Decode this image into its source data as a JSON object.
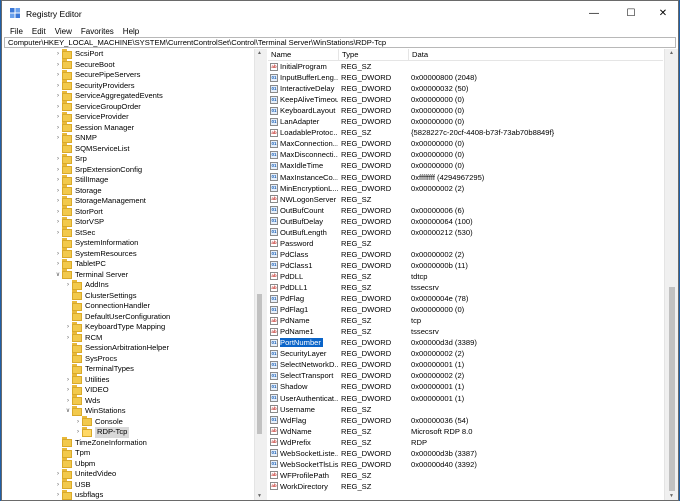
{
  "title": "Registry Editor",
  "window_controls": {
    "minimize": "—",
    "maximize": "☐",
    "close": "✕"
  },
  "menu": [
    "File",
    "Edit",
    "View",
    "Favorites",
    "Help"
  ],
  "address": "Computer\\HKEY_LOCAL_MACHINE\\SYSTEM\\CurrentControlSet\\Control\\Terminal Server\\WinStations\\RDP-Tcp",
  "tree": [
    {
      "label": "ScsiPort",
      "depth": 0,
      "exp": "collapsed"
    },
    {
      "label": "SecureBoot",
      "depth": 0,
      "exp": "collapsed"
    },
    {
      "label": "SecurePipeServers",
      "depth": 0,
      "exp": "collapsed"
    },
    {
      "label": "SecurityProviders",
      "depth": 0,
      "exp": "collapsed"
    },
    {
      "label": "ServiceAggregatedEvents",
      "depth": 0,
      "exp": "collapsed"
    },
    {
      "label": "ServiceGroupOrder",
      "depth": 0,
      "exp": "collapsed"
    },
    {
      "label": "ServiceProvider",
      "depth": 0,
      "exp": "collapsed"
    },
    {
      "label": "Session Manager",
      "depth": 0,
      "exp": "collapsed"
    },
    {
      "label": "SNMP",
      "depth": 0,
      "exp": "collapsed"
    },
    {
      "label": "SQMServiceList",
      "depth": 0,
      "exp": "none"
    },
    {
      "label": "Srp",
      "depth": 0,
      "exp": "collapsed"
    },
    {
      "label": "SrpExtensionConfig",
      "depth": 0,
      "exp": "collapsed"
    },
    {
      "label": "StillImage",
      "depth": 0,
      "exp": "collapsed"
    },
    {
      "label": "Storage",
      "depth": 0,
      "exp": "collapsed"
    },
    {
      "label": "StorageManagement",
      "depth": 0,
      "exp": "collapsed"
    },
    {
      "label": "StorPort",
      "depth": 0,
      "exp": "collapsed"
    },
    {
      "label": "StorVSP",
      "depth": 0,
      "exp": "collapsed"
    },
    {
      "label": "StSec",
      "depth": 0,
      "exp": "collapsed"
    },
    {
      "label": "SystemInformation",
      "depth": 0,
      "exp": "none"
    },
    {
      "label": "SystemResources",
      "depth": 0,
      "exp": "collapsed"
    },
    {
      "label": "TabletPC",
      "depth": 0,
      "exp": "collapsed"
    },
    {
      "label": "Terminal Server",
      "depth": 0,
      "exp": "expanded"
    },
    {
      "label": "AddIns",
      "depth": 1,
      "exp": "collapsed"
    },
    {
      "label": "ClusterSettings",
      "depth": 1,
      "exp": "none"
    },
    {
      "label": "ConnectionHandler",
      "depth": 1,
      "exp": "none"
    },
    {
      "label": "DefaultUserConfiguration",
      "depth": 1,
      "exp": "none"
    },
    {
      "label": "KeyboardType Mapping",
      "depth": 1,
      "exp": "collapsed"
    },
    {
      "label": "RCM",
      "depth": 1,
      "exp": "collapsed"
    },
    {
      "label": "SessionArbitrationHelper",
      "depth": 1,
      "exp": "none"
    },
    {
      "label": "SysProcs",
      "depth": 1,
      "exp": "none"
    },
    {
      "label": "TerminalTypes",
      "depth": 1,
      "exp": "none"
    },
    {
      "label": "Utilities",
      "depth": 1,
      "exp": "collapsed"
    },
    {
      "label": "VIDEO",
      "depth": 1,
      "exp": "collapsed"
    },
    {
      "label": "Wds",
      "depth": 1,
      "exp": "collapsed"
    },
    {
      "label": "WinStations",
      "depth": 1,
      "exp": "expanded"
    },
    {
      "label": "Console",
      "depth": 2,
      "exp": "collapsed"
    },
    {
      "label": "RDP-Tcp",
      "depth": 2,
      "exp": "collapsed",
      "selected": true
    },
    {
      "label": "TimeZoneInformation",
      "depth": 0,
      "exp": "none"
    },
    {
      "label": "Tpm",
      "depth": 0,
      "exp": "none"
    },
    {
      "label": "Ubpm",
      "depth": 0,
      "exp": "none"
    },
    {
      "label": "UnitedVideo",
      "depth": 0,
      "exp": "collapsed"
    },
    {
      "label": "USB",
      "depth": 0,
      "exp": "collapsed"
    },
    {
      "label": "usbflags",
      "depth": 0,
      "exp": "collapsed"
    }
  ],
  "columns": {
    "name": "Name",
    "type": "Type",
    "data": "Data"
  },
  "values": [
    {
      "name": "InitialProgram",
      "type": "REG_SZ",
      "data": ""
    },
    {
      "name": "InputBufferLeng...",
      "type": "REG_DWORD",
      "data": "0x00000800 (2048)"
    },
    {
      "name": "InteractiveDelay",
      "type": "REG_DWORD",
      "data": "0x00000032 (50)"
    },
    {
      "name": "KeepAliveTimeout",
      "type": "REG_DWORD",
      "data": "0x00000000 (0)"
    },
    {
      "name": "KeyboardLayout",
      "type": "REG_DWORD",
      "data": "0x00000000 (0)"
    },
    {
      "name": "LanAdapter",
      "type": "REG_DWORD",
      "data": "0x00000000 (0)"
    },
    {
      "name": "LoadableProtoc...",
      "type": "REG_SZ",
      "data": "{5828227c-20cf-4408-b73f-73ab70b8849f}"
    },
    {
      "name": "MaxConnection...",
      "type": "REG_DWORD",
      "data": "0x00000000 (0)"
    },
    {
      "name": "MaxDisconnecti...",
      "type": "REG_DWORD",
      "data": "0x00000000 (0)"
    },
    {
      "name": "MaxIdleTime",
      "type": "REG_DWORD",
      "data": "0x00000000 (0)"
    },
    {
      "name": "MaxInstanceCo...",
      "type": "REG_DWORD",
      "data": "0xffffffff (4294967295)"
    },
    {
      "name": "MinEncryptionL...",
      "type": "REG_DWORD",
      "data": "0x00000002 (2)"
    },
    {
      "name": "NWLogonServer",
      "type": "REG_SZ",
      "data": ""
    },
    {
      "name": "OutBufCount",
      "type": "REG_DWORD",
      "data": "0x00000006 (6)"
    },
    {
      "name": "OutBufDelay",
      "type": "REG_DWORD",
      "data": "0x00000064 (100)"
    },
    {
      "name": "OutBufLength",
      "type": "REG_DWORD",
      "data": "0x00000212 (530)"
    },
    {
      "name": "Password",
      "type": "REG_SZ",
      "data": ""
    },
    {
      "name": "PdClass",
      "type": "REG_DWORD",
      "data": "0x00000002 (2)"
    },
    {
      "name": "PdClass1",
      "type": "REG_DWORD",
      "data": "0x0000000b (11)"
    },
    {
      "name": "PdDLL",
      "type": "REG_SZ",
      "data": "tdtcp"
    },
    {
      "name": "PdDLL1",
      "type": "REG_SZ",
      "data": "tssecsrv"
    },
    {
      "name": "PdFlag",
      "type": "REG_DWORD",
      "data": "0x0000004e (78)"
    },
    {
      "name": "PdFlag1",
      "type": "REG_DWORD",
      "data": "0x00000000 (0)"
    },
    {
      "name": "PdName",
      "type": "REG_SZ",
      "data": "tcp"
    },
    {
      "name": "PdName1",
      "type": "REG_SZ",
      "data": "tssecsrv"
    },
    {
      "name": "PortNumber",
      "type": "REG_DWORD",
      "data": "0x00000d3d (3389)",
      "selected": true
    },
    {
      "name": "SecurityLayer",
      "type": "REG_DWORD",
      "data": "0x00000002 (2)"
    },
    {
      "name": "SelectNetworkD...",
      "type": "REG_DWORD",
      "data": "0x00000001 (1)"
    },
    {
      "name": "SelectTransport",
      "type": "REG_DWORD",
      "data": "0x00000002 (2)"
    },
    {
      "name": "Shadow",
      "type": "REG_DWORD",
      "data": "0x00000001 (1)"
    },
    {
      "name": "UserAuthenticat...",
      "type": "REG_DWORD",
      "data": "0x00000001 (1)"
    },
    {
      "name": "Username",
      "type": "REG_SZ",
      "data": ""
    },
    {
      "name": "WdFlag",
      "type": "REG_DWORD",
      "data": "0x00000036 (54)"
    },
    {
      "name": "WdName",
      "type": "REG_SZ",
      "data": "Microsoft RDP 8.0"
    },
    {
      "name": "WdPrefix",
      "type": "REG_SZ",
      "data": "RDP"
    },
    {
      "name": "WebSocketListe...",
      "type": "REG_DWORD",
      "data": "0x00000d3b (3387)"
    },
    {
      "name": "WebSocketTlsLis...",
      "type": "REG_DWORD",
      "data": "0x00000d40 (3392)"
    },
    {
      "name": "WFProfilePath",
      "type": "REG_SZ",
      "data": ""
    },
    {
      "name": "WorkDirectory",
      "type": "REG_SZ",
      "data": ""
    }
  ]
}
